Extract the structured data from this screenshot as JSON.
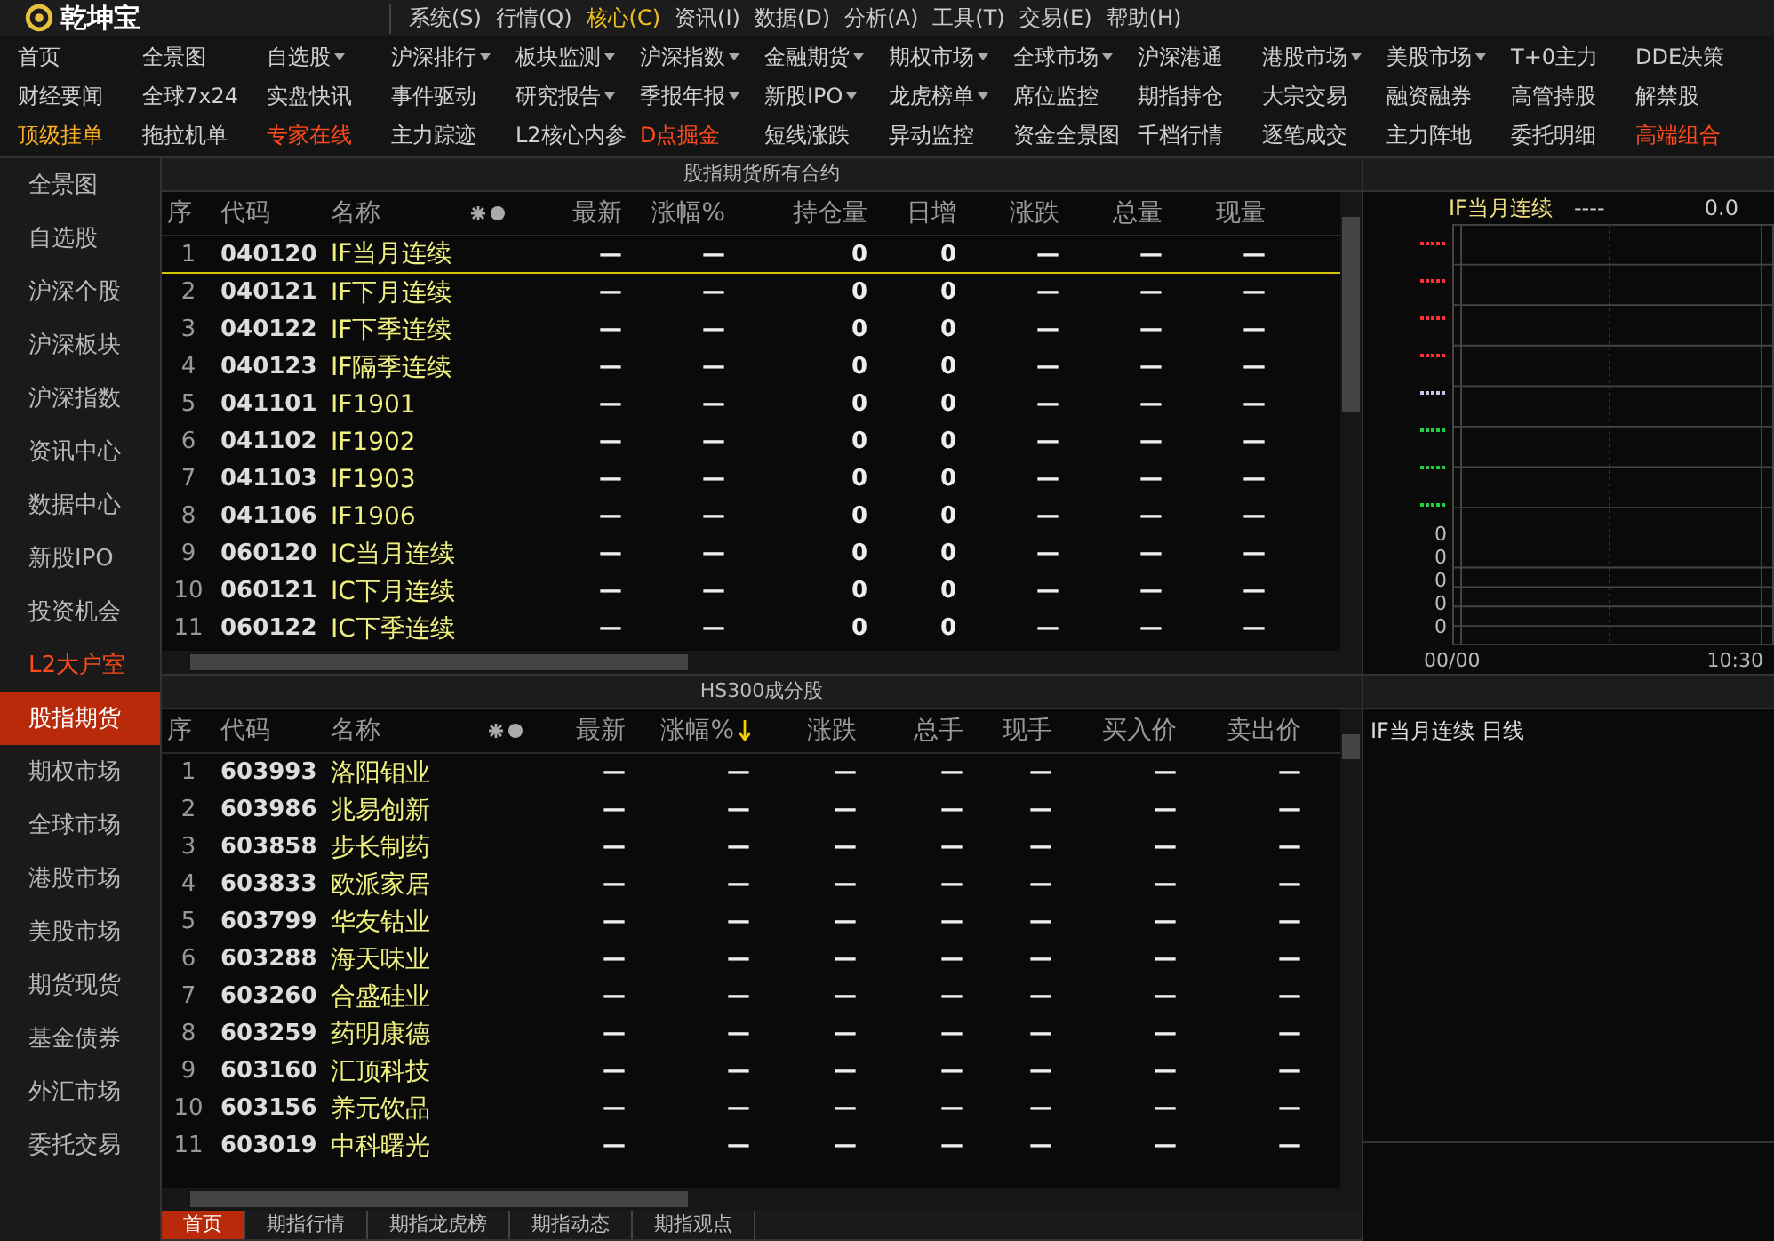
{
  "app": {
    "name": "乾坤宝"
  },
  "menu": [
    {
      "label": "系统(S)",
      "selected": false
    },
    {
      "label": "行情(Q)",
      "selected": false
    },
    {
      "label": "核心(C)",
      "selected": true
    },
    {
      "label": "资讯(I)",
      "selected": false
    },
    {
      "label": "数据(D)",
      "selected": false
    },
    {
      "label": "分析(A)",
      "selected": false
    },
    {
      "label": "工具(T)",
      "selected": false
    },
    {
      "label": "交易(E)",
      "selected": false
    },
    {
      "label": "帮助(H)",
      "selected": false
    }
  ],
  "quick_nav": [
    [
      {
        "label": "首页",
        "dropdown": false,
        "color": "#d0d0d0"
      },
      {
        "label": "全景图",
        "dropdown": false,
        "color": "#d0d0d0"
      },
      {
        "label": "自选股",
        "dropdown": true,
        "color": "#d0d0d0"
      },
      {
        "label": "沪深排行",
        "dropdown": true,
        "color": "#d0d0d0"
      },
      {
        "label": "板块监测",
        "dropdown": true,
        "color": "#d0d0d0"
      },
      {
        "label": "沪深指数",
        "dropdown": true,
        "color": "#d0d0d0"
      },
      {
        "label": "金融期货",
        "dropdown": true,
        "color": "#d0d0d0"
      },
      {
        "label": "期权市场",
        "dropdown": true,
        "color": "#d0d0d0"
      },
      {
        "label": "全球市场",
        "dropdown": true,
        "color": "#d0d0d0"
      },
      {
        "label": "沪深港通",
        "dropdown": false,
        "color": "#d0d0d0"
      },
      {
        "label": "港股市场",
        "dropdown": true,
        "color": "#d0d0d0"
      },
      {
        "label": "美股市场",
        "dropdown": true,
        "color": "#d0d0d0"
      },
      {
        "label": "T+0主力",
        "dropdown": false,
        "color": "#d0d0d0"
      },
      {
        "label": "DDE决策",
        "dropdown": false,
        "color": "#d0d0d0"
      }
    ],
    [
      {
        "label": "财经要闻",
        "dropdown": false,
        "color": "#d0d0d0"
      },
      {
        "label": "全球7x24",
        "dropdown": false,
        "color": "#d0d0d0"
      },
      {
        "label": "实盘快讯",
        "dropdown": false,
        "color": "#d0d0d0"
      },
      {
        "label": "事件驱动",
        "dropdown": false,
        "color": "#d0d0d0"
      },
      {
        "label": "研究报告",
        "dropdown": true,
        "color": "#d0d0d0"
      },
      {
        "label": "季报年报",
        "dropdown": true,
        "color": "#d0d0d0"
      },
      {
        "label": "新股IPO",
        "dropdown": true,
        "color": "#d0d0d0"
      },
      {
        "label": "龙虎榜单",
        "dropdown": true,
        "color": "#d0d0d0"
      },
      {
        "label": "席位监控",
        "dropdown": false,
        "color": "#d0d0d0"
      },
      {
        "label": "期指持仓",
        "dropdown": false,
        "color": "#d0d0d0"
      },
      {
        "label": "大宗交易",
        "dropdown": false,
        "color": "#d0d0d0"
      },
      {
        "label": "融资融券",
        "dropdown": false,
        "color": "#d0d0d0"
      },
      {
        "label": "高管持股",
        "dropdown": false,
        "color": "#d0d0d0"
      },
      {
        "label": "解禁股",
        "dropdown": false,
        "color": "#d0d0d0"
      }
    ],
    [
      {
        "label": "顶级挂单",
        "dropdown": false,
        "color": "#ffb020"
      },
      {
        "label": "拖拉机单",
        "dropdown": false,
        "color": "#d0d0d0"
      },
      {
        "label": "专家在线",
        "dropdown": false,
        "color": "#ff4a1a"
      },
      {
        "label": "主力踪迹",
        "dropdown": false,
        "color": "#d0d0d0"
      },
      {
        "label": "L2核心内参",
        "dropdown": false,
        "color": "#d0d0d0"
      },
      {
        "label": "D点掘金",
        "dropdown": false,
        "color": "#ff4a1a"
      },
      {
        "label": "短线涨跌",
        "dropdown": false,
        "color": "#d0d0d0"
      },
      {
        "label": "异动监控",
        "dropdown": false,
        "color": "#d0d0d0"
      },
      {
        "label": "资金全景图",
        "dropdown": false,
        "color": "#d0d0d0"
      },
      {
        "label": "千档行情",
        "dropdown": false,
        "color": "#d0d0d0"
      },
      {
        "label": "逐笔成交",
        "dropdown": false,
        "color": "#d0d0d0"
      },
      {
        "label": "主力阵地",
        "dropdown": false,
        "color": "#d0d0d0"
      },
      {
        "label": "委托明细",
        "dropdown": false,
        "color": "#d0d0d0"
      },
      {
        "label": "高端组合",
        "dropdown": false,
        "color": "#ff4a1a"
      }
    ]
  ],
  "sidebar": {
    "items": [
      {
        "label": "全景图",
        "selected": false,
        "kind": "normal"
      },
      {
        "label": "自选股",
        "selected": false,
        "kind": "normal"
      },
      {
        "label": "沪深个股",
        "selected": false,
        "kind": "normal"
      },
      {
        "label": "沪深板块",
        "selected": false,
        "kind": "normal"
      },
      {
        "label": "沪深指数",
        "selected": false,
        "kind": "normal"
      },
      {
        "label": "资讯中心",
        "selected": false,
        "kind": "normal"
      },
      {
        "label": "数据中心",
        "selected": false,
        "kind": "normal"
      },
      {
        "label": "新股IPO",
        "selected": false,
        "kind": "normal"
      },
      {
        "label": "投资机会",
        "selected": false,
        "kind": "normal"
      },
      {
        "label": "L2大户室",
        "selected": false,
        "kind": "premium"
      },
      {
        "label": "股指期货",
        "selected": true,
        "kind": "normal"
      },
      {
        "label": "期权市场",
        "selected": false,
        "kind": "normal"
      },
      {
        "label": "全球市场",
        "selected": false,
        "kind": "normal"
      },
      {
        "label": "港股市场",
        "selected": false,
        "kind": "normal"
      },
      {
        "label": "美股市场",
        "selected": false,
        "kind": "normal"
      },
      {
        "label": "期货现货",
        "selected": false,
        "kind": "normal"
      },
      {
        "label": "基金债券",
        "selected": false,
        "kind": "normal"
      },
      {
        "label": "外汇市场",
        "selected": false,
        "kind": "normal"
      },
      {
        "label": "委托交易",
        "selected": false,
        "kind": "normal"
      }
    ]
  },
  "futures_table": {
    "title": "股指期货所有合约",
    "columns": [
      "序",
      "代码",
      "名称",
      "最新",
      "涨幅%",
      "持仓量",
      "日增",
      "涨跌",
      "总量",
      "现量"
    ],
    "rows": [
      {
        "cells": [
          "1",
          "040120",
          "IF当月连续",
          "—",
          "—",
          "0",
          "0",
          "—",
          "—",
          "—"
        ],
        "selected": true
      },
      {
        "cells": [
          "2",
          "040121",
          "IF下月连续",
          "—",
          "—",
          "0",
          "0",
          "—",
          "—",
          "—"
        ],
        "selected": false
      },
      {
        "cells": [
          "3",
          "040122",
          "IF下季连续",
          "—",
          "—",
          "0",
          "0",
          "—",
          "—",
          "—"
        ],
        "selected": false
      },
      {
        "cells": [
          "4",
          "040123",
          "IF隔季连续",
          "—",
          "—",
          "0",
          "0",
          "—",
          "—",
          "—"
        ],
        "selected": false
      },
      {
        "cells": [
          "5",
          "041101",
          "IF1901",
          "—",
          "—",
          "0",
          "0",
          "—",
          "—",
          "—"
        ],
        "selected": false
      },
      {
        "cells": [
          "6",
          "041102",
          "IF1902",
          "—",
          "—",
          "0",
          "0",
          "—",
          "—",
          "—"
        ],
        "selected": false
      },
      {
        "cells": [
          "7",
          "041103",
          "IF1903",
          "—",
          "—",
          "0",
          "0",
          "—",
          "—",
          "—"
        ],
        "selected": false
      },
      {
        "cells": [
          "8",
          "041106",
          "IF1906",
          "—",
          "—",
          "0",
          "0",
          "—",
          "—",
          "—"
        ],
        "selected": false
      },
      {
        "cells": [
          "9",
          "060120",
          "IC当月连续",
          "—",
          "—",
          "0",
          "0",
          "—",
          "—",
          "—"
        ],
        "selected": false
      },
      {
        "cells": [
          "10",
          "060121",
          "IC下月连续",
          "—",
          "—",
          "0",
          "0",
          "—",
          "—",
          "—"
        ],
        "selected": false
      },
      {
        "cells": [
          "11",
          "060122",
          "IC下季连续",
          "—",
          "—",
          "0",
          "0",
          "—",
          "—",
          "—"
        ],
        "selected": false
      }
    ]
  },
  "stocks_table": {
    "title": "HS300成分股",
    "columns": [
      {
        "label": "序",
        "sorted": false
      },
      {
        "label": "代码",
        "sorted": false
      },
      {
        "label": "名称",
        "sorted": false
      },
      {
        "label": "最新",
        "sorted": false
      },
      {
        "label": "涨幅%",
        "sorted": true
      },
      {
        "label": "涨跌",
        "sorted": false
      },
      {
        "label": "总手",
        "sorted": false
      },
      {
        "label": "现手",
        "sorted": false
      },
      {
        "label": "买入价",
        "sorted": false
      },
      {
        "label": "卖出价",
        "sorted": false
      }
    ],
    "rows": [
      {
        "cells": [
          "1",
          "603993",
          "洛阳钼业",
          "—",
          "—",
          "—",
          "—",
          "—",
          "—",
          "—"
        ]
      },
      {
        "cells": [
          "2",
          "603986",
          "兆易创新",
          "—",
          "—",
          "—",
          "—",
          "—",
          "—",
          "—"
        ]
      },
      {
        "cells": [
          "3",
          "603858",
          "步长制药",
          "—",
          "—",
          "—",
          "—",
          "—",
          "—",
          "—"
        ]
      },
      {
        "cells": [
          "4",
          "603833",
          "欧派家居",
          "—",
          "—",
          "—",
          "—",
          "—",
          "—",
          "—"
        ]
      },
      {
        "cells": [
          "5",
          "603799",
          "华友钴业",
          "—",
          "—",
          "—",
          "—",
          "—",
          "—",
          "—"
        ]
      },
      {
        "cells": [
          "6",
          "603288",
          "海天味业",
          "—",
          "—",
          "—",
          "—",
          "—",
          "—",
          "—"
        ]
      },
      {
        "cells": [
          "7",
          "603260",
          "合盛硅业",
          "—",
          "—",
          "—",
          "—",
          "—",
          "—",
          "—"
        ]
      },
      {
        "cells": [
          "8",
          "603259",
          "药明康德",
          "—",
          "—",
          "—",
          "—",
          "—",
          "—",
          "—"
        ]
      },
      {
        "cells": [
          "9",
          "603160",
          "汇顶科技",
          "—",
          "—",
          "—",
          "—",
          "—",
          "—",
          "—"
        ]
      },
      {
        "cells": [
          "10",
          "603156",
          "养元饮品",
          "—",
          "—",
          "—",
          "—",
          "—",
          "—",
          "—"
        ]
      },
      {
        "cells": [
          "11",
          "603019",
          "中科曙光",
          "—",
          "—",
          "—",
          "—",
          "—",
          "—",
          "—"
        ]
      }
    ]
  },
  "intraday_chart": {
    "title": "IF当月连续",
    "change": "----",
    "price": "0.0",
    "price_ticks": [
      {
        "color": "#ff3030"
      },
      {
        "color": "#ff3030"
      },
      {
        "color": "#ff3030"
      },
      {
        "color": "#ff3030"
      },
      {
        "color": "#c8c8e8"
      },
      {
        "color": "#20d040"
      },
      {
        "color": "#20d040"
      },
      {
        "color": "#20d040"
      }
    ],
    "volume_labels": [
      "0",
      "0",
      "0",
      "0",
      "0"
    ],
    "time_labels": [
      "00/00",
      "10:30"
    ]
  },
  "daily_chart": {
    "title": "IF当月连续 日线"
  },
  "bottom_tabs": [
    {
      "label": "首页",
      "selected": true
    },
    {
      "label": "期指行情",
      "selected": false
    },
    {
      "label": "期指龙虎榜",
      "selected": false
    },
    {
      "label": "期指动态",
      "selected": false
    },
    {
      "label": "期指观点",
      "selected": false
    }
  ]
}
